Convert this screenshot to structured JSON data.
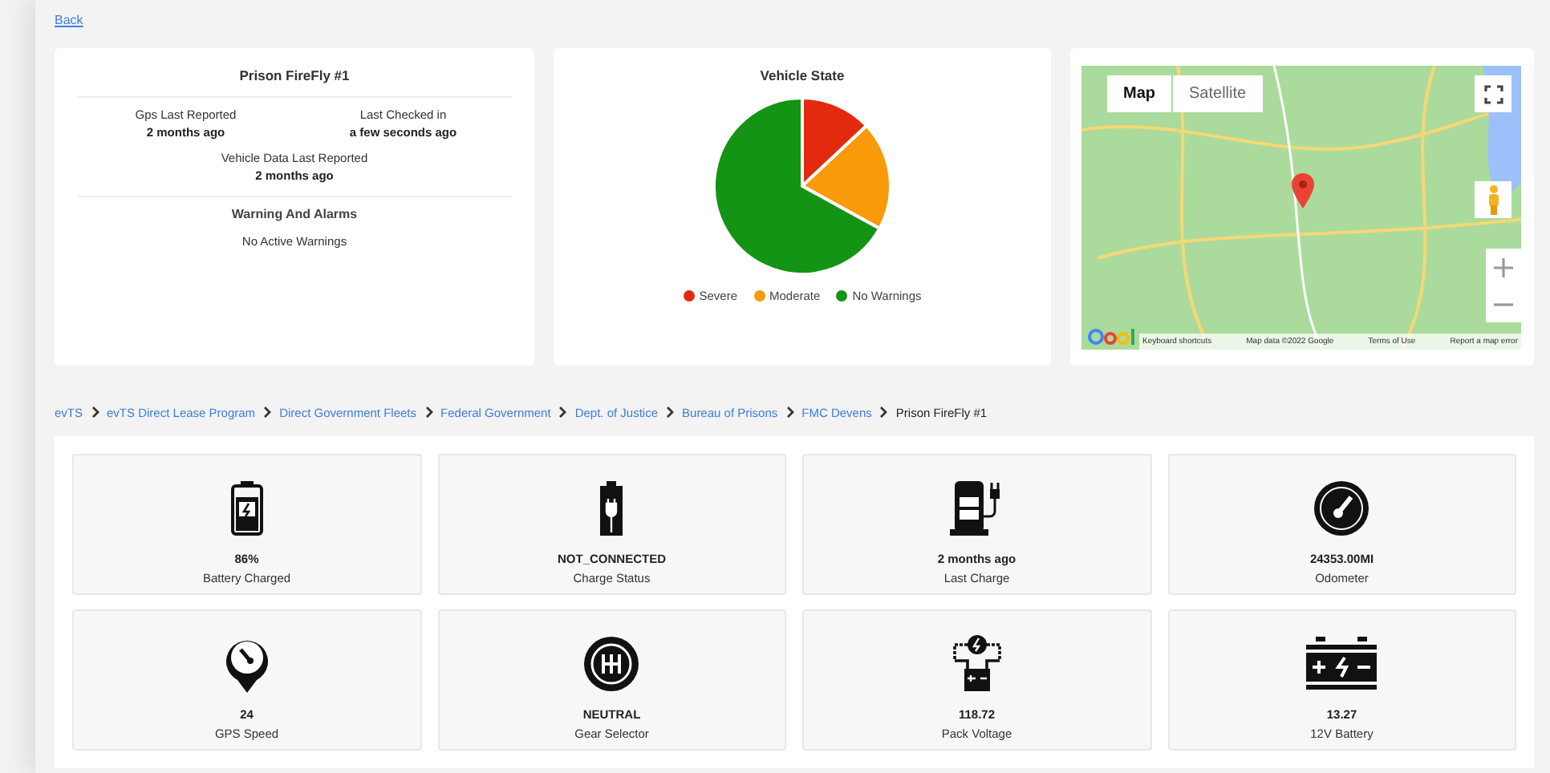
{
  "back_link": "Back",
  "vehicle_card": {
    "title": "Prison FireFly #1",
    "facts": [
      {
        "label": "Gps Last Reported",
        "value": "2 months ago"
      },
      {
        "label": "Last Checked in",
        "value": "a few seconds ago"
      },
      {
        "label": "Vehicle Data Last Reported",
        "value": "2 months ago"
      }
    ],
    "warnings_title": "Warning And Alarms",
    "warnings_text": "No Active Warnings"
  },
  "vehicle_state": {
    "title": "Vehicle State",
    "legend": [
      {
        "label": "Severe",
        "color": "#e32a0e"
      },
      {
        "label": "Moderate",
        "color": "#f89a0a"
      },
      {
        "label": "No Warnings",
        "color": "#149414"
      }
    ]
  },
  "map": {
    "types": [
      {
        "label": "Map",
        "selected": true
      },
      {
        "label": "Satellite",
        "selected": false
      }
    ],
    "footer": [
      "Keyboard shortcuts",
      "Map data ©2022 Google",
      "Terms of Use",
      "Report a map error"
    ]
  },
  "breadcrumb": [
    {
      "label": "evTS",
      "link": true
    },
    {
      "label": "evTS Direct Lease Program",
      "link": true
    },
    {
      "label": "Direct Government Fleets",
      "link": true
    },
    {
      "label": "Federal Government",
      "link": true
    },
    {
      "label": "Dept. of Justice",
      "link": true
    },
    {
      "label": "Bureau of Prisons",
      "link": true
    },
    {
      "label": "FMC Devens",
      "link": true
    },
    {
      "label": "Prison FireFly #1",
      "link": false
    }
  ],
  "metrics": [
    {
      "kind": "battery",
      "value": "86%",
      "label": "Battery Charged"
    },
    {
      "kind": "charge",
      "value": "NOT_CONNECTED",
      "label": "Charge Status"
    },
    {
      "kind": "station",
      "value": "2 months ago",
      "label": "Last Charge"
    },
    {
      "kind": "odometer",
      "value": "24353.00MI",
      "label": "Odometer"
    },
    {
      "kind": "speed",
      "value": "24",
      "label": "GPS Speed"
    },
    {
      "kind": "gear",
      "value": "NEUTRAL",
      "label": "Gear Selector"
    },
    {
      "kind": "pack",
      "value": "118.72",
      "label": "Pack Voltage"
    },
    {
      "kind": "car-battery",
      "value": "13.27",
      "label": "12V Battery"
    }
  ]
}
